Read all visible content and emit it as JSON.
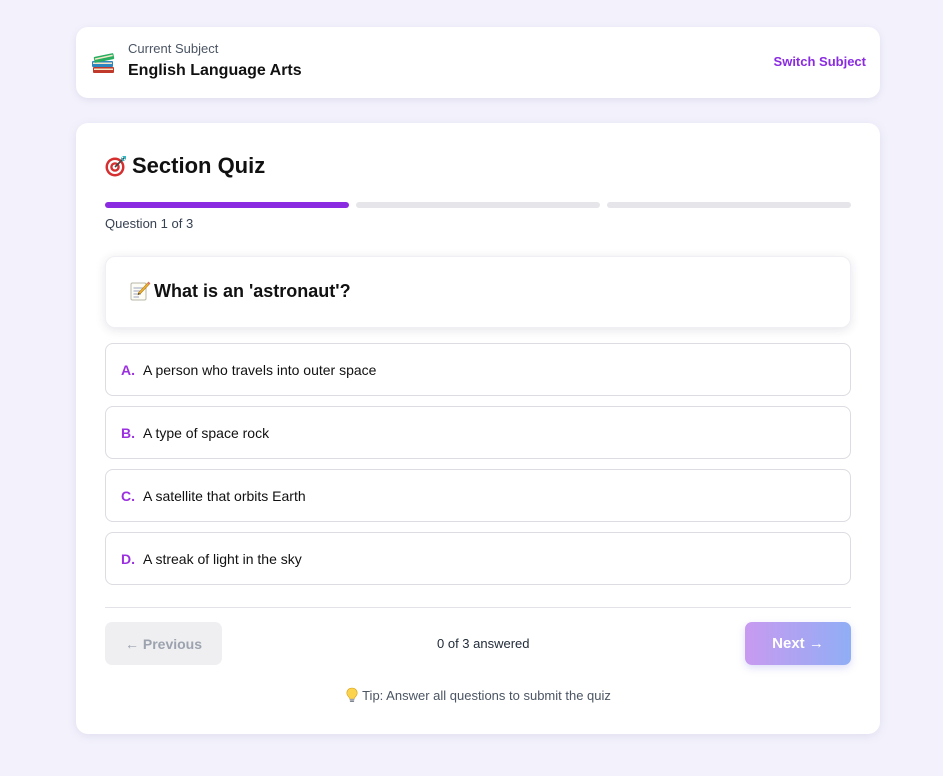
{
  "subject": {
    "icon": "books-icon",
    "caption": "Current Subject",
    "name": "English Language Arts",
    "switch_label": "Switch Subject"
  },
  "quiz": {
    "icon": "target-icon",
    "title": "Section Quiz",
    "progress": {
      "current": 1,
      "total": 3
    },
    "counter": "Question 1 of 3",
    "question": {
      "icon": "memo-icon",
      "text": "What is an 'astronaut'?"
    },
    "options": [
      {
        "letter": "A.",
        "text": "A person who travels into outer space"
      },
      {
        "letter": "B.",
        "text": "A type of space rock"
      },
      {
        "letter": "C.",
        "text": "A satellite that orbits Earth"
      },
      {
        "letter": "D.",
        "text": "A streak of light in the sky"
      }
    ],
    "prev_label": "← Previous",
    "answered": "0 of 3 answered",
    "next_label": "Next →",
    "tip": "Tip: Answer all questions to submit the quiz",
    "tip_icon": "lightbulb-icon"
  },
  "colors": {
    "accent": "#8a2be2",
    "background": "#f3f2fc",
    "next_gradient": [
      "#c89af0",
      "#90aef5"
    ]
  }
}
